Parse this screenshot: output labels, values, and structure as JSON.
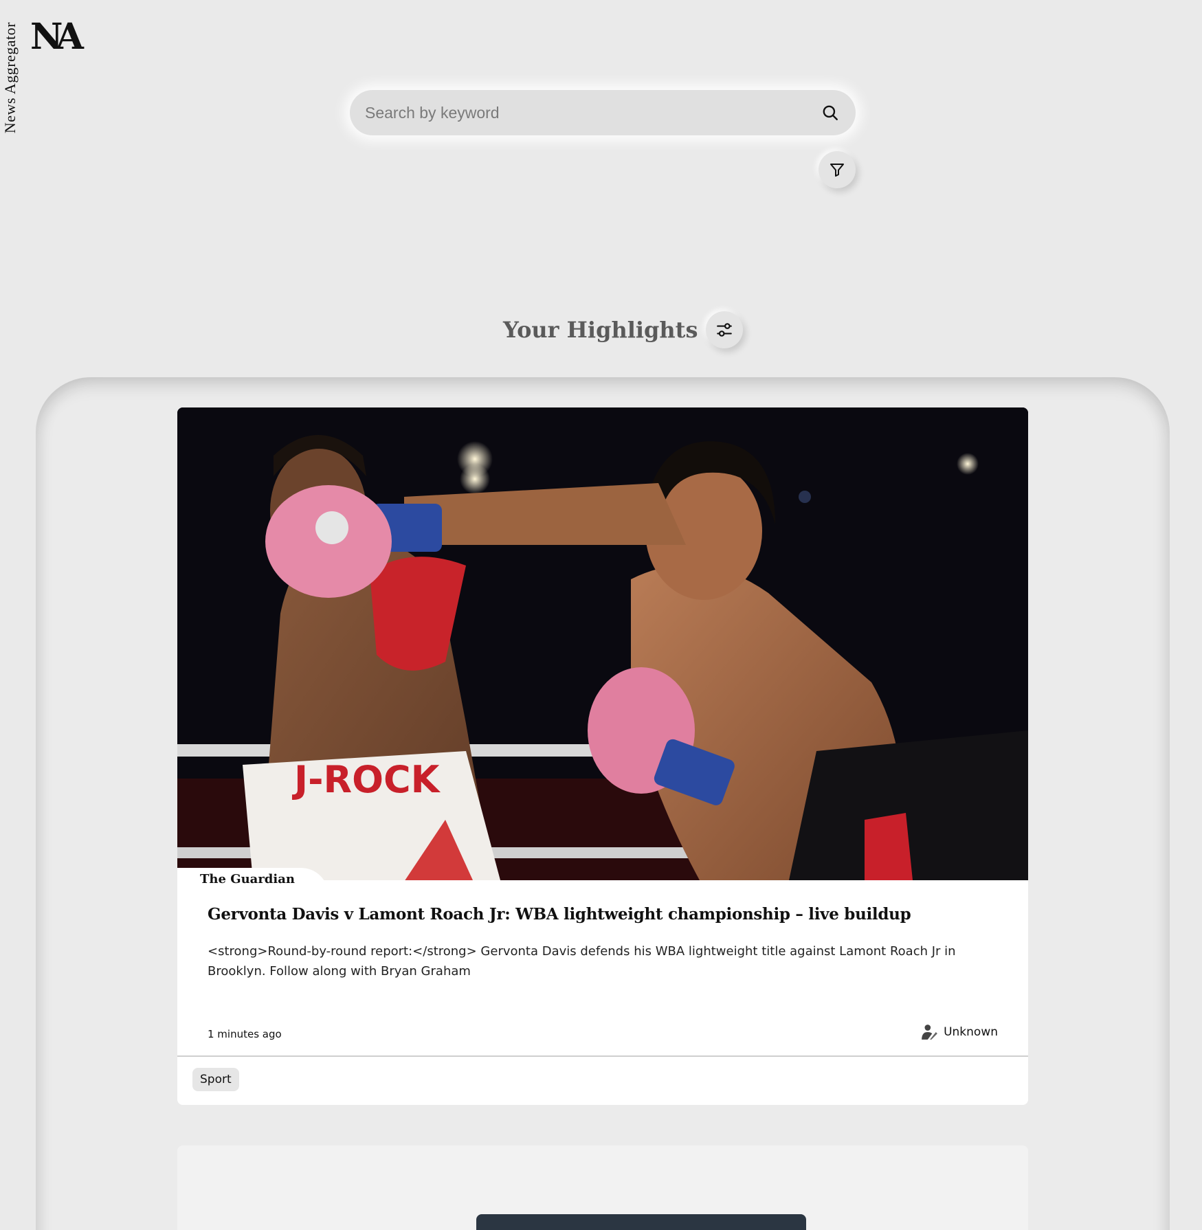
{
  "app": {
    "name": "News Aggregator",
    "logo_text": "NA"
  },
  "search": {
    "placeholder": "Search by keyword",
    "value": ""
  },
  "highlights": {
    "title": "Your Highlights"
  },
  "articles": [
    {
      "source": "The Guardian",
      "title": "Gervonta Davis v Lamont Roach Jr: WBA lightweight championship – live buildup",
      "description": "<strong>Round-by-round report:</strong> Gervonta Davis defends his WBA lightweight title against Lamont Roach Jr in Brooklyn. Follow along with Bryan Graham",
      "time": "1 minutes ago",
      "author": "Unknown",
      "category": "Sport",
      "image_alt": "Two boxers in a ring; one throws a punch with a pink glove",
      "image_text": "J-ROCK"
    }
  ],
  "icons": {
    "search": "search-icon",
    "filter": "filter-icon",
    "settings": "sliders-icon",
    "author": "author-icon"
  },
  "colors": {
    "background": "#eaeaea",
    "card": "#ffffff",
    "heading": "#5a5a5a",
    "tag": "#e6e6e6"
  }
}
